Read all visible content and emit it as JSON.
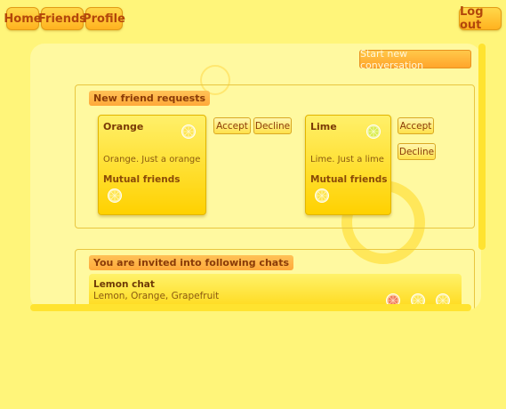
{
  "nav": {
    "home_label": "Home",
    "friends_label": "Friends",
    "profile_label": "Profile",
    "logout_label": "Log out"
  },
  "actions": {
    "start_conversation_label": "Start new conversation"
  },
  "friend_requests": {
    "title": "New friend requests",
    "accept_label": "Accept",
    "decline_label": "Decline",
    "items": [
      {
        "name": "Orange",
        "description": "Orange. Just a orange",
        "mutual_label": "Mutual friends"
      },
      {
        "name": "Lime",
        "description": "Lime. Just a lime",
        "mutual_label": "Mutual friends"
      }
    ]
  },
  "chat_invites": {
    "title": "You are invited into following chats",
    "items": [
      {
        "name": "Lemon chat",
        "members": "Lemon, Orange, Grapefruit"
      }
    ]
  },
  "colors": {
    "background": "#fff57a",
    "nav_button": "#ffb21f",
    "nav_text": "#b3470b",
    "card": "#ffd100"
  },
  "icons": {
    "fruit": "citrus-slice-icon"
  }
}
